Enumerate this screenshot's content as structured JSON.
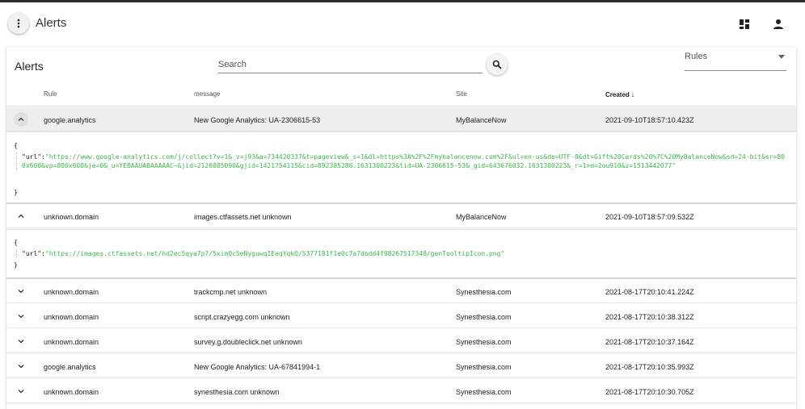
{
  "app": {
    "title": "Alerts"
  },
  "card": {
    "title": "Alerts",
    "search": {
      "placeholder": "Search",
      "value": ""
    },
    "rules_filter": {
      "label": "Rules"
    }
  },
  "table": {
    "columns": {
      "rule": "Rule",
      "message": "message",
      "site": "Site",
      "created": "Created"
    },
    "sort": {
      "column": "Created",
      "direction": "descending"
    },
    "rows": [
      {
        "rule": "google.analytics",
        "message": "New Google Analytics: UA-2306615-53",
        "site": "MyBalanceNow",
        "created": "2021-09-10T18:57:10.423Z",
        "expanded": true,
        "detail": {
          "open": "{",
          "key": "\"url\":",
          "value": "\"https://www.google-analytics.com/j/collect?v=1&_v=j93&a=734420337&t=pageview&_s=1&dl=https%3A%2F%2Fmybalancenow.com%2F&ul=en-us&de=UTF-8&dt=Gift%20Cards%20%7C%20MyBalanceNow&sd=24-bit&sr=800x600&vp=800x600&je=0&_u=YEBAAUABAAAAAC~&jid=2126085090&gjid=1421754115&cid=892385286.1631300223&tid=UA-2306615-53&_gid=643676032.1631300223&_r=1>m=2ou910&z=1513442077\"",
          "close": "}"
        }
      },
      {
        "rule": "unknown.domain",
        "message": "images.ctfassets.net unknown",
        "site": "MyBalanceNow",
        "created": "2021-09-10T18:57:09.532Z",
        "expanded": true,
        "detail": {
          "open": "{",
          "key": "\"url\":",
          "value": "\"https://images.ctfassets.net/hd2ec5qya7p7/5xim0c5eNyguwqIEeqYqkQ/5377181f1e0c7a7dbdd4f98267517348/genTooltipIcon.png\"",
          "close": "}"
        }
      },
      {
        "rule": "unknown.domain",
        "message": "trackcmp.net unknown",
        "site": "Synesthesia.com",
        "created": "2021-08-17T20:10:41.224Z",
        "expanded": false
      },
      {
        "rule": "unknown.domain",
        "message": "script.crazyegg.com unknown",
        "site": "Synesthesia.com",
        "created": "2021-08-17T20:10:38.312Z",
        "expanded": false
      },
      {
        "rule": "unknown.domain",
        "message": "survey.g.doubleclick.net unknown",
        "site": "Synesthesia.com",
        "created": "2021-08-17T20:10:37.164Z",
        "expanded": false
      },
      {
        "rule": "google.analytics",
        "message": "New Google Analytics: UA-67841994-1",
        "site": "Synesthesia.com",
        "created": "2021-08-17T20:10:35.993Z",
        "expanded": false
      },
      {
        "rule": "unknown.domain",
        "message": "synesthesia.com unknown",
        "site": "Synesthesia.com",
        "created": "2021-08-17T20:10:30.705Z",
        "expanded": false
      }
    ]
  },
  "icons": {
    "menu": "more-vert-icon",
    "dashboard": "dashboard-icon",
    "account": "person-icon",
    "search": "search-icon",
    "dropdown": "arrow-drop-down-icon",
    "expand": "chevron-down-icon",
    "collapse": "chevron-up-icon"
  },
  "colors": {
    "json_string": "#3db84b",
    "expanded_row_bg": "#eeeeee"
  }
}
